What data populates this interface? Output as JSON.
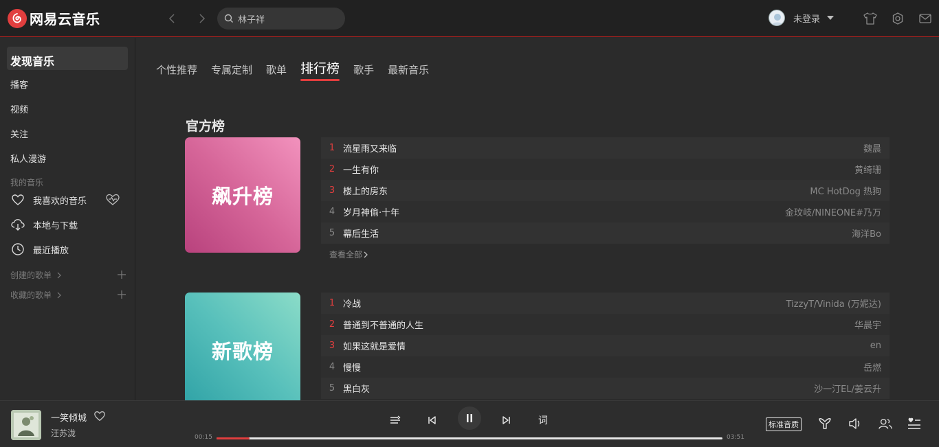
{
  "app": {
    "name": "网易云音乐",
    "accent": "#e13e3e"
  },
  "search": {
    "value": "林子祥"
  },
  "user": {
    "name": "未登录"
  },
  "sidebar": {
    "active": "发现音乐",
    "items": [
      "播客",
      "视频",
      "关注",
      "私人漫游"
    ],
    "my_music_title": "我的音乐",
    "my_music": [
      "我喜欢的音乐",
      "本地与下载",
      "最近播放"
    ],
    "created_playlists": "创建的歌单",
    "collected_playlists": "收藏的歌单"
  },
  "tabs": [
    {
      "label": "个性推荐",
      "active": false
    },
    {
      "label": "专属定制",
      "active": false
    },
    {
      "label": "歌单",
      "active": false
    },
    {
      "label": "排行榜",
      "active": true
    },
    {
      "label": "歌手",
      "active": false
    },
    {
      "label": "最新音乐",
      "active": false
    }
  ],
  "section_title": "官方榜",
  "charts": [
    {
      "name": "飙升榜",
      "songs": [
        {
          "rank": "1",
          "title": "流星雨又来临",
          "artist": "魏晨"
        },
        {
          "rank": "2",
          "title": "一生有你",
          "artist": "黄绮珊"
        },
        {
          "rank": "3",
          "title": "楼上的房东",
          "artist": "MC HotDog 热狗"
        },
        {
          "rank": "4",
          "title": "岁月神偷·十年",
          "artist": "金玟岐/NINEONE#乃万"
        },
        {
          "rank": "5",
          "title": "幕后生活",
          "artist": "海洋Bo"
        }
      ],
      "see_all": "查看全部"
    },
    {
      "name": "新歌榜",
      "songs": [
        {
          "rank": "1",
          "title": "冷战",
          "artist": "TizzyT/Vinida (万妮达)"
        },
        {
          "rank": "2",
          "title": "普通到不普通的人生",
          "artist": "华晨宇"
        },
        {
          "rank": "3",
          "title": "如果这就是爱情",
          "artist": "en"
        },
        {
          "rank": "4",
          "title": "慢慢",
          "artist": "岳燃"
        },
        {
          "rank": "5",
          "title": "黑白灰",
          "artist": "沙一汀EL/姜云升"
        }
      ]
    }
  ],
  "player": {
    "track": "一笑倾城",
    "artist": "汪苏泷",
    "current_time": "00:15",
    "total_time": "03:51",
    "progress": 0.065,
    "lyrics_label": "词",
    "quality": "标准音质"
  }
}
